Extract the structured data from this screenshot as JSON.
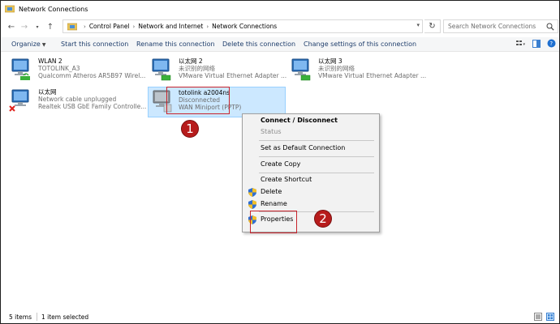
{
  "window": {
    "title": "Network Connections"
  },
  "address": {
    "crumbs": [
      "Control Panel",
      "Network and Internet",
      "Network Connections"
    ]
  },
  "search": {
    "placeholder": "Search Network Connections"
  },
  "toolbar": {
    "organize": "Organize",
    "start": "Start this connection",
    "rename": "Rename this connection",
    "delete": "Delete this connection",
    "change": "Change settings of this connection"
  },
  "connections": [
    {
      "name": "WLAN 2",
      "line1": "TOTOLINK_A3",
      "line2": "Qualcomm Atheros AR5B97 Wirel..."
    },
    {
      "name": "以太网 2",
      "line1": "未识别的网络",
      "line2": "VMware Virtual Ethernet Adapter ..."
    },
    {
      "name": "以太网 3",
      "line1": "未识别的网络",
      "line2": "VMware Virtual Ethernet Adapter ..."
    },
    {
      "name": "以太网",
      "line1": "Network cable unplugged",
      "line2": "Realtek USB GbE Family Controlle..."
    },
    {
      "name": "totolink a2004ns",
      "line1": "Disconnected",
      "line2": "WAN Miniport (PPTP)"
    }
  ],
  "context_menu": {
    "items": [
      "Connect / Disconnect",
      "Status",
      "Set as Default Connection",
      "Create Copy",
      "Create Shortcut",
      "Delete",
      "Rename",
      "Properties"
    ]
  },
  "annotations": {
    "marker1": "1",
    "marker2": "2",
    "color": "#b71c1c"
  },
  "status": {
    "count": "5 items",
    "selected": "1 item selected"
  },
  "icons": [
    "network-folder-icon",
    "back-arrow-icon",
    "forward-arrow-icon",
    "recent-dropdown-icon",
    "up-arrow-icon",
    "refresh-icon",
    "search-icon",
    "network-adapter-icon",
    "shield-icon"
  ]
}
